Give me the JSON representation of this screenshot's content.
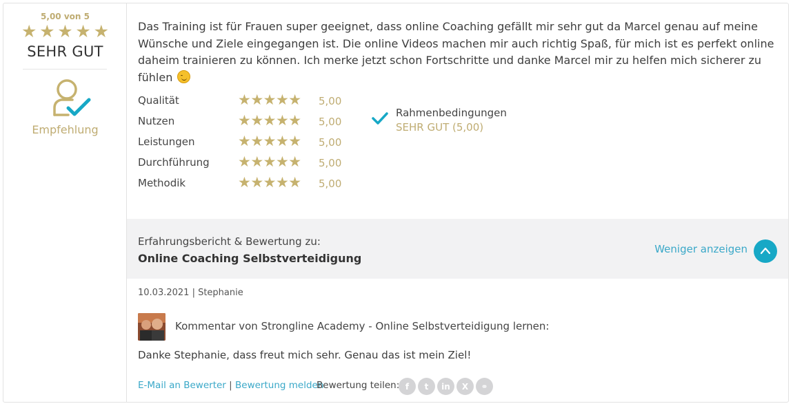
{
  "overall": {
    "score_text": "5,00 von 5",
    "stars": [
      "★",
      "★",
      "★",
      "★",
      "★"
    ],
    "verdict": "SEHR GUT",
    "recommend_label": "Empfehlung",
    "recommend_icon": "user-check-icon"
  },
  "review": {
    "text": "Das Training ist für Frauen super geeignet, dass online Coaching gefällt mir sehr gut da Marcel genau auf meine Wünsche und Ziele eingegangen ist. Die online Videos machen mir auch richtig Spaß, für mich ist es perfekt online daheim trainieren zu können. Ich merke jetzt schon Fortschritte und danke Marcel mir zu helfen mich sicherer zu fühlen",
    "emoji": "smiling-face-icon"
  },
  "criteria": [
    {
      "label": "Qualität",
      "stars": "★★★★★",
      "value": "5,00"
    },
    {
      "label": "Nutzen",
      "stars": "★★★★★",
      "value": "5,00"
    },
    {
      "label": "Leistungen",
      "stars": "★★★★★",
      "value": "5,00"
    },
    {
      "label": "Durchführung",
      "stars": "★★★★★",
      "value": "5,00"
    },
    {
      "label": "Methodik",
      "stars": "★★★★★",
      "value": "5,00"
    }
  ],
  "framework": {
    "title": "Rahmenbedingungen",
    "value": "SEHR GUT (5,00)"
  },
  "band": {
    "label": "Erfahrungsbericht & Bewertung zu:",
    "title": "Online Coaching Selbstverteidigung",
    "less_link": "Weniger anzeigen"
  },
  "meta": {
    "text": "10.03.2021 | Stephanie"
  },
  "comment": {
    "label": "Kommentar von Strongline Academy - Online Selbstverteidigung lernen:",
    "text": "Danke Stephanie, dass freut mich sehr. Genau das ist mein Ziel!"
  },
  "actions": {
    "email": "E-Mail an Bewerter",
    "separator": "|",
    "report": "Bewertung melden",
    "share_label": "Bewertung teilen:",
    "share_icons": [
      {
        "name": "facebook-icon",
        "glyph": "f"
      },
      {
        "name": "twitter-icon",
        "glyph": "t"
      },
      {
        "name": "linkedin-icon",
        "glyph": "in"
      },
      {
        "name": "xing-icon",
        "glyph": "X"
      },
      {
        "name": "link-icon",
        "glyph": "⚭"
      }
    ]
  },
  "colors": {
    "gold": "#c6b26f",
    "accent": "#17a8c6",
    "link": "#3aa8c8",
    "band_bg": "#f2f2f3"
  }
}
